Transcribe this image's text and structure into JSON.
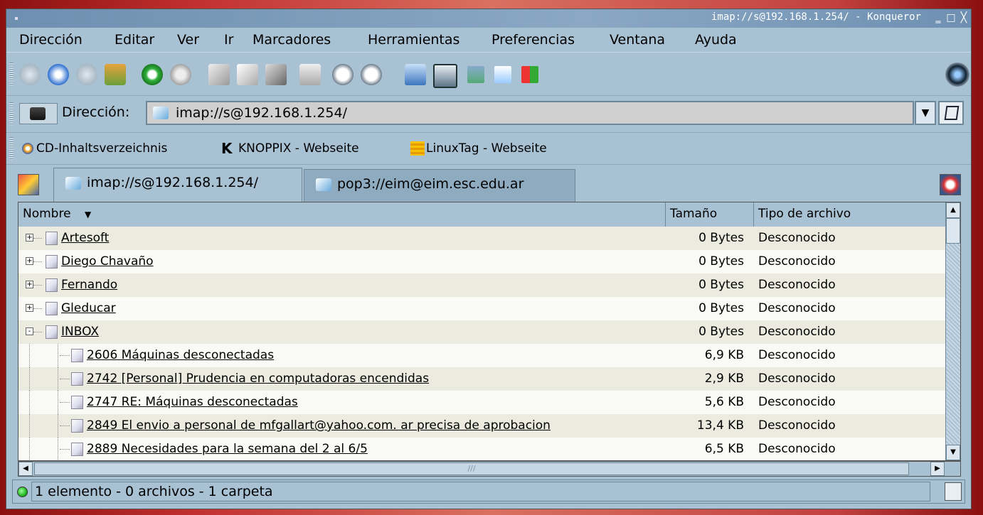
{
  "window": {
    "title": "imap://s@192.168.1.254/ - Konqueror"
  },
  "menu": [
    "Dirección",
    "Editar",
    "Ver",
    "Ir",
    "Marcadores",
    "Herramientas",
    "Preferencias",
    "Ventana",
    "Ayuda"
  ],
  "location": {
    "label": "Dirección:",
    "url": "imap://s@192.168.1.254/"
  },
  "bookmarks": [
    "CD-Inhaltsverzeichnis",
    "KNOPPIX - Webseite",
    "LinuxTag - Webseite"
  ],
  "tabs": [
    "imap://s@192.168.1.254/",
    "pop3://eim@eim.esc.edu.ar"
  ],
  "columns": {
    "name": "Nombre",
    "size": "Tamaño",
    "type": "Tipo de archivo"
  },
  "rows": [
    {
      "name": "Artesoft",
      "size": "0 Bytes",
      "type": "Desconocido",
      "level": 0,
      "expander": "+"
    },
    {
      "name": "Diego Chavaño",
      "size": "0 Bytes",
      "type": "Desconocido",
      "level": 0,
      "expander": "+"
    },
    {
      "name": "Fernando",
      "size": "0 Bytes",
      "type": "Desconocido",
      "level": 0,
      "expander": "+"
    },
    {
      "name": "Gleducar",
      "size": "0 Bytes",
      "type": "Desconocido",
      "level": 0,
      "expander": "+"
    },
    {
      "name": "INBOX",
      "size": "0 Bytes",
      "type": "Desconocido",
      "level": 0,
      "expander": "-"
    },
    {
      "name": "2606 Máquinas desconectadas ",
      "size": "6,9 KB",
      "type": "Desconocido",
      "level": 1
    },
    {
      "name": "2742 [Personal] Prudencia en computadoras encendidas",
      "size": "2,9 KB",
      "type": "Desconocido",
      "level": 1
    },
    {
      "name": "2747 RE: Máquinas desconectadas ",
      "size": "5,6 KB",
      "type": "Desconocido",
      "level": 1
    },
    {
      "name": "2849 El envio a personal de mfgallart@yahoo.com. ar precisa de aprobacion",
      "size": "13,4 KB",
      "type": "Desconocido",
      "level": 1
    },
    {
      "name": "2889 Necesidades para la semana del 2 al 6/5",
      "size": "6,5 KB",
      "type": "Desconocido",
      "level": 1
    }
  ],
  "status": "1 elemento - 0 archivos - 1 carpeta"
}
